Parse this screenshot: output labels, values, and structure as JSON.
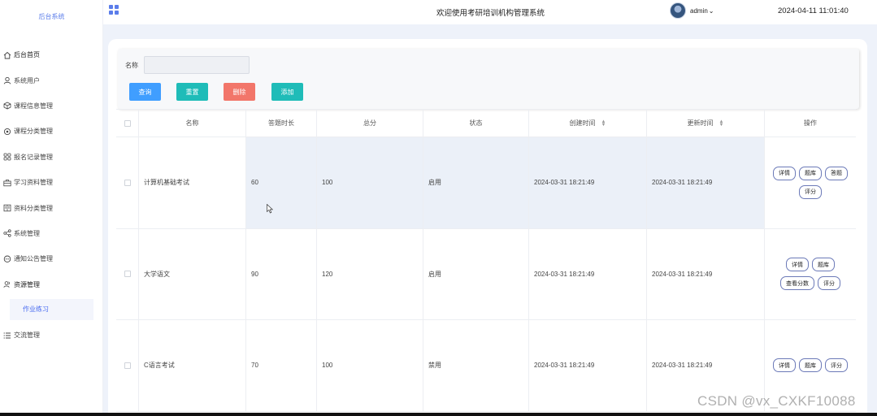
{
  "sidebar": {
    "brand": "后台系统",
    "items": [
      {
        "label": "后台首页",
        "icon": "home-icon"
      },
      {
        "label": "系统用户",
        "icon": "user-icon"
      },
      {
        "label": "课程信息管理",
        "icon": "cube-icon"
      },
      {
        "label": "课程分类管理",
        "icon": "settings-icon"
      },
      {
        "label": "报名记录管理",
        "icon": "grid-icon"
      },
      {
        "label": "学习资料管理",
        "icon": "briefcase-icon"
      },
      {
        "label": "资料分类管理",
        "icon": "book-icon"
      },
      {
        "label": "系统管理",
        "icon": "share-icon"
      },
      {
        "label": "通知公告管理",
        "icon": "chat-icon"
      },
      {
        "label": "资源管理",
        "icon": "users-icon"
      }
    ],
    "sub_item": "作业练习",
    "last_item": {
      "label": "交流管理",
      "icon": "list-icon"
    }
  },
  "header": {
    "title": "欢迎使用考研培训机构管理系统",
    "user": "admin",
    "datetime": "2024-04-11 11:01:40",
    "accent": "#5b7dea"
  },
  "search": {
    "label": "名称",
    "value": "",
    "buttons": {
      "query": "查询",
      "reset": "重置",
      "delete": "删除",
      "add": "添加"
    },
    "colors": {
      "query": "#409eff",
      "reset": "#1fbcb8",
      "delete": "#f2766a",
      "add": "#1fbcb8"
    }
  },
  "table": {
    "columns": [
      "名称",
      "答题时长",
      "总分",
      "状态",
      "创建时间",
      "更新时间",
      "操作"
    ],
    "rows": [
      {
        "name": "计算机基础考试",
        "duration": "60",
        "score": "100",
        "status": "启用",
        "created": "2024-03-31 18:21:49",
        "updated": "2024-03-31 18:21:49",
        "actions": [
          "详情",
          "题库",
          "答题",
          "评分"
        ]
      },
      {
        "name": "大学语文",
        "duration": "90",
        "score": "120",
        "status": "启用",
        "created": "2024-03-31 18:21:49",
        "updated": "2024-03-31 18:21:49",
        "actions": [
          "详情",
          "题库",
          "查看分数",
          "评分"
        ]
      },
      {
        "name": "C语言考试",
        "duration": "70",
        "score": "100",
        "status": "禁用",
        "created": "2024-03-31 18:21:49",
        "updated": "2024-03-31 18:21:49",
        "actions": [
          "详情",
          "题库",
          "评分"
        ]
      }
    ]
  },
  "watermark": "CSDN @vx_CXKF10088"
}
